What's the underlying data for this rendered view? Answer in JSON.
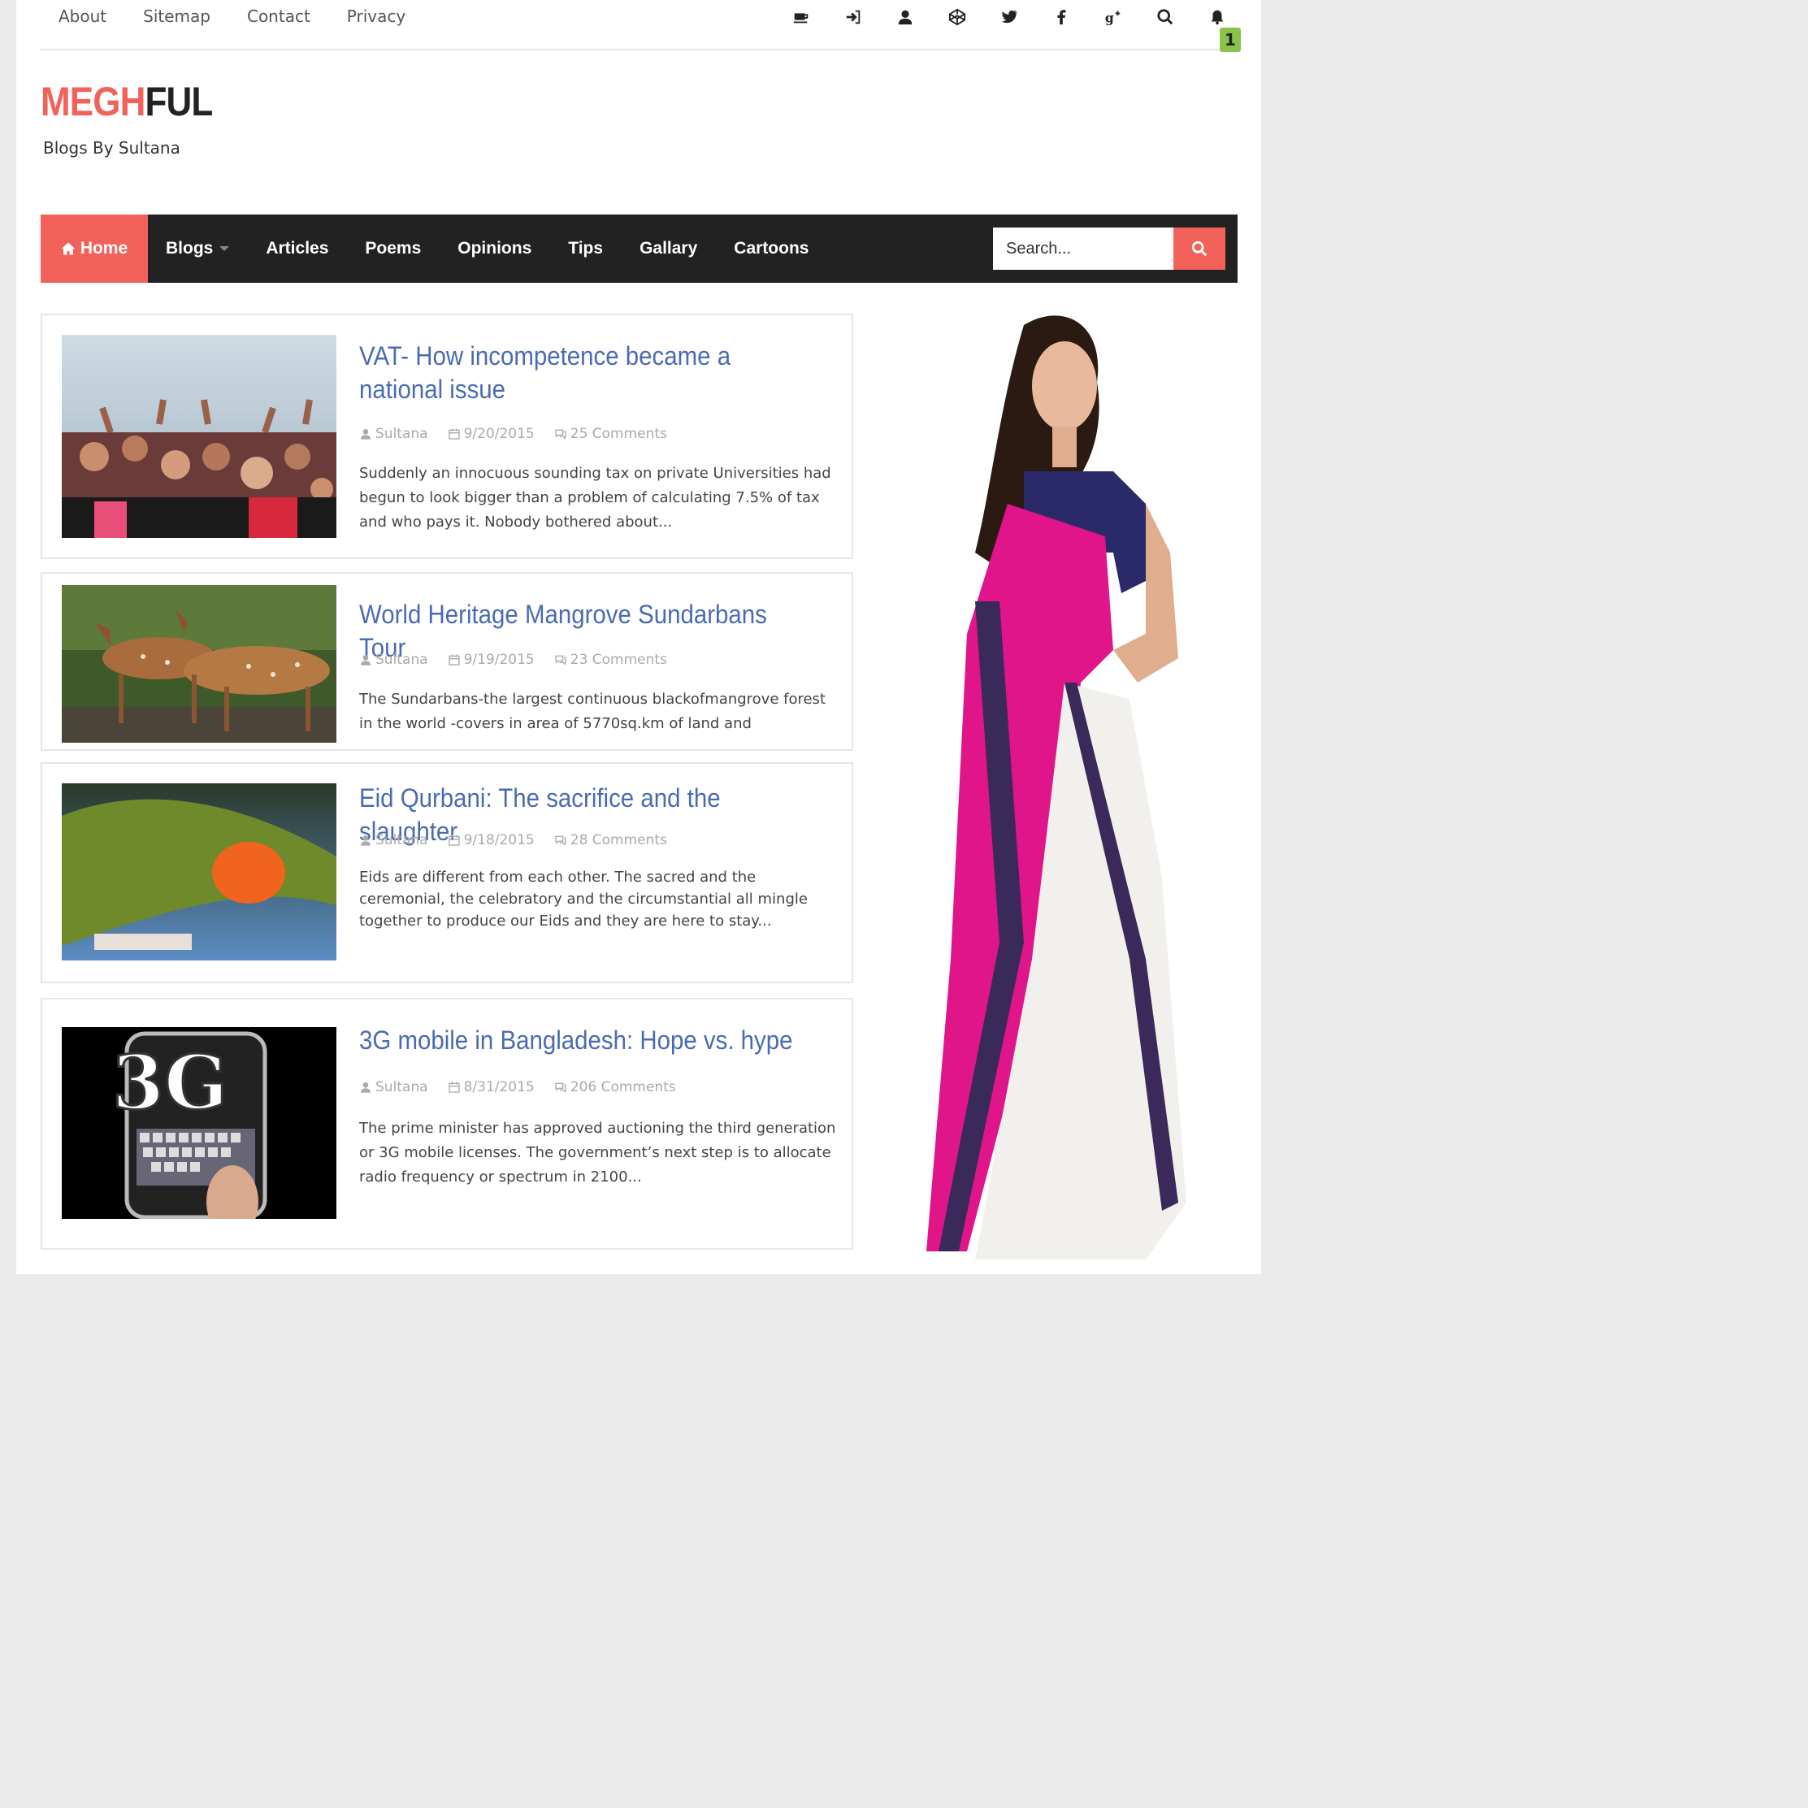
{
  "topbar": {
    "links": [
      "About",
      "Sitemap",
      "Contact",
      "Privacy"
    ],
    "icons": [
      "coffee-icon",
      "sign-in-icon",
      "user-icon",
      "codepen-icon",
      "twitter-icon",
      "facebook-icon",
      "google-plus-icon",
      "search-icon",
      "bell-icon"
    ],
    "notification_count": "1"
  },
  "brand": {
    "logo_part1": "MEGH",
    "logo_part2": "FUL",
    "tagline": "Blogs By Sultana",
    "accent_color": "#f2625b",
    "title_color": "#4a6bb3"
  },
  "nav": {
    "home": "Home",
    "items": [
      "Blogs",
      "Articles",
      "Poems",
      "Opinions",
      "Tips",
      "Gallary",
      "Cartoons"
    ],
    "search_placeholder": "Search..."
  },
  "posts": [
    {
      "title": "VAT- How incompetence became a national issue",
      "author": "Sultana",
      "date": "9/20/2015",
      "comments": "25 Comments",
      "excerpt": "Suddenly an innocuous sounding tax on private Universities had begun to look bigger than a problem of calculating 7.5% of tax and who pays it. Nobody bothered about...",
      "image": "crowd-photo"
    },
    {
      "title": "World Heritage Mangrove Sundarbans Tour",
      "author": "Sultana",
      "date": "9/19/2015",
      "comments": "23 Comments",
      "excerpt": "The Sundarbans-the largest continuous blackofmangrove forest in the world -covers in area of 5770sq.km of land and",
      "image": "deer-photo"
    },
    {
      "title": "Eid Qurbani: The sacrifice and the slaughter",
      "author": "Sultana",
      "date": "9/18/2015",
      "comments": "28 Comments",
      "excerpt": "Eids are different from each other. The sacred and the ceremonial, the celebratory and the circumstantial all mingle together to produce our Eids and they are here to stay...",
      "image": "flag-photo"
    },
    {
      "title": "3G mobile in Bangladesh: Hope vs. hype",
      "author": "Sultana",
      "date": "8/31/2015",
      "comments": "206 Comments",
      "excerpt": "The prime minister has approved auctioning the third generation or 3G mobile licenses. The government’s next step is to allocate radio frequency or spectrum in 2100...",
      "image": "phone-3g-photo",
      "thumb_text": "3G"
    }
  ],
  "sidebar": {
    "image": "saree-model-advertisement"
  }
}
